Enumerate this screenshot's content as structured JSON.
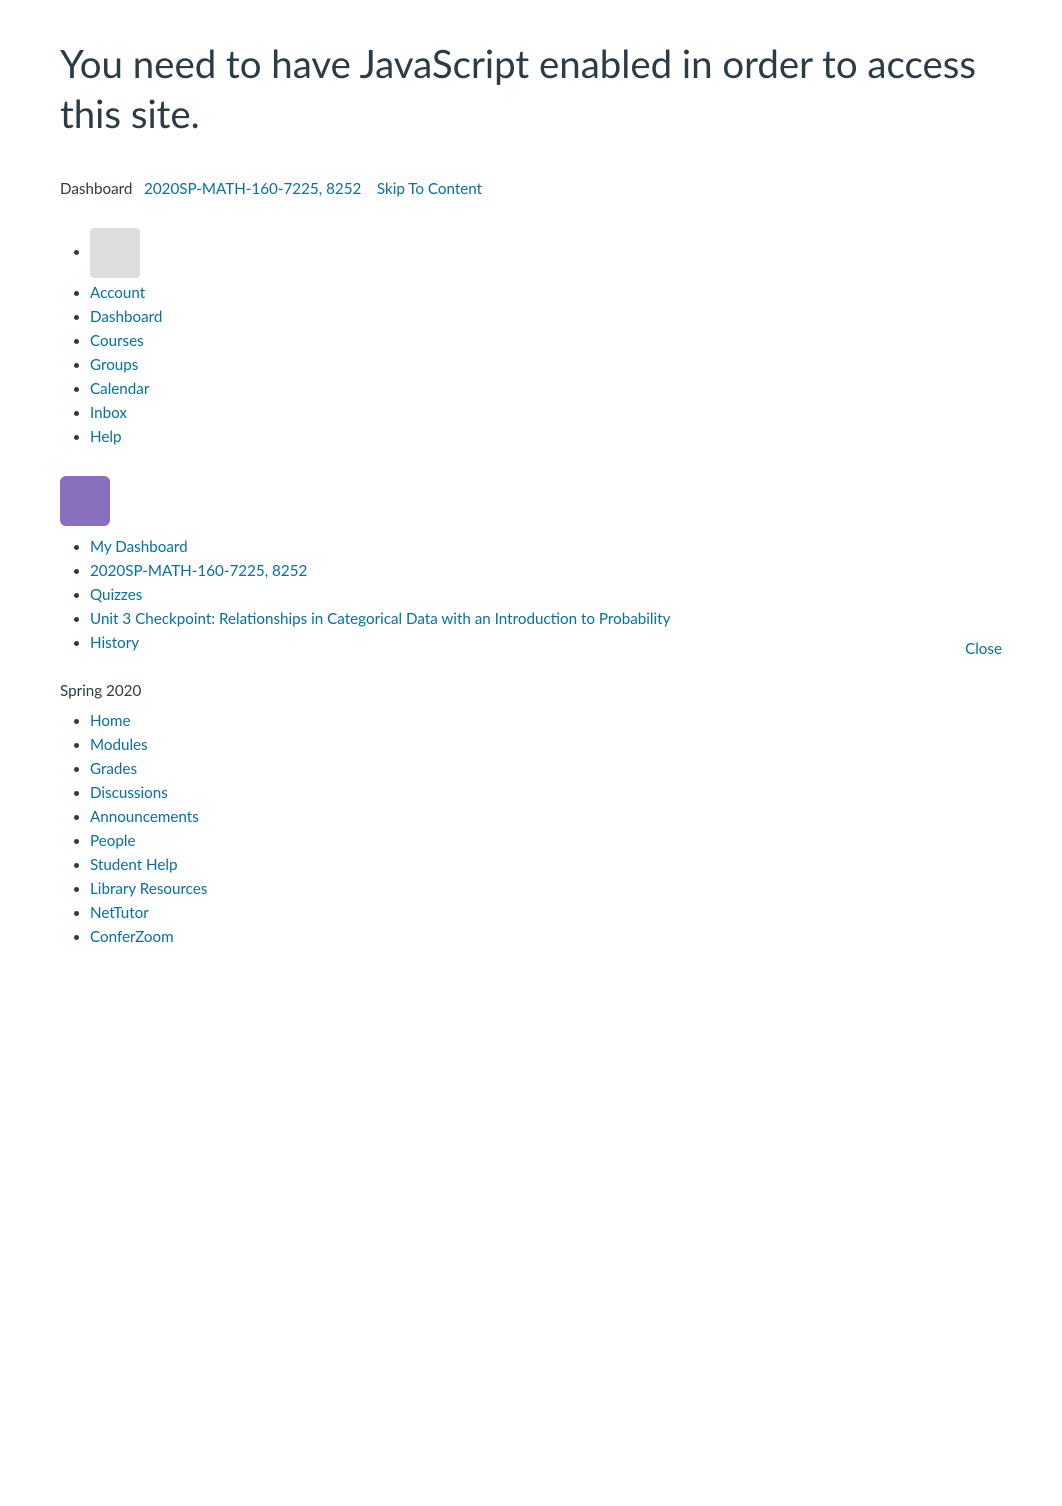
{
  "page": {
    "warning_title": "You need to have JavaScript enabled in order to access this site.",
    "breadcrumb_dashboard": "Dashboard",
    "breadcrumb_course": "2020SP-MATH-160-7225, 8252",
    "breadcrumb_skip": "Skip To Content",
    "close_label": "Close",
    "semester_label": "Spring 2020"
  },
  "global_nav": {
    "items": [
      {
        "label": "Account",
        "href": "#"
      },
      {
        "label": "Dashboard",
        "href": "#"
      },
      {
        "label": "Courses",
        "href": "#"
      },
      {
        "label": "Groups",
        "href": "#"
      },
      {
        "label": "Calendar",
        "href": "#"
      },
      {
        "label": "Inbox",
        "href": "#"
      },
      {
        "label": "Help",
        "href": "#"
      }
    ]
  },
  "course_panel": {
    "items": [
      {
        "label": "My Dashboard",
        "href": "#"
      },
      {
        "label": "2020SP-MATH-160-7225, 8252",
        "href": "#"
      },
      {
        "label": "Quizzes",
        "href": "#"
      },
      {
        "label": "Unit 3 Checkpoint: Relationships in Categorical Data with an Introduction to Probability",
        "href": "#"
      },
      {
        "label": "History",
        "href": "#"
      }
    ]
  },
  "course_nav": {
    "items": [
      {
        "label": "Home",
        "href": "#"
      },
      {
        "label": "Modules",
        "href": "#"
      },
      {
        "label": "Grades",
        "href": "#"
      },
      {
        "label": "Discussions",
        "href": "#"
      },
      {
        "label": "Announcements",
        "href": "#"
      },
      {
        "label": "People",
        "href": "#"
      },
      {
        "label": "Student Help",
        "href": "#"
      },
      {
        "label": "Library Resources",
        "href": "#"
      },
      {
        "label": "NetTutor",
        "href": "#"
      },
      {
        "label": "ConferZoom",
        "href": "#"
      }
    ]
  }
}
